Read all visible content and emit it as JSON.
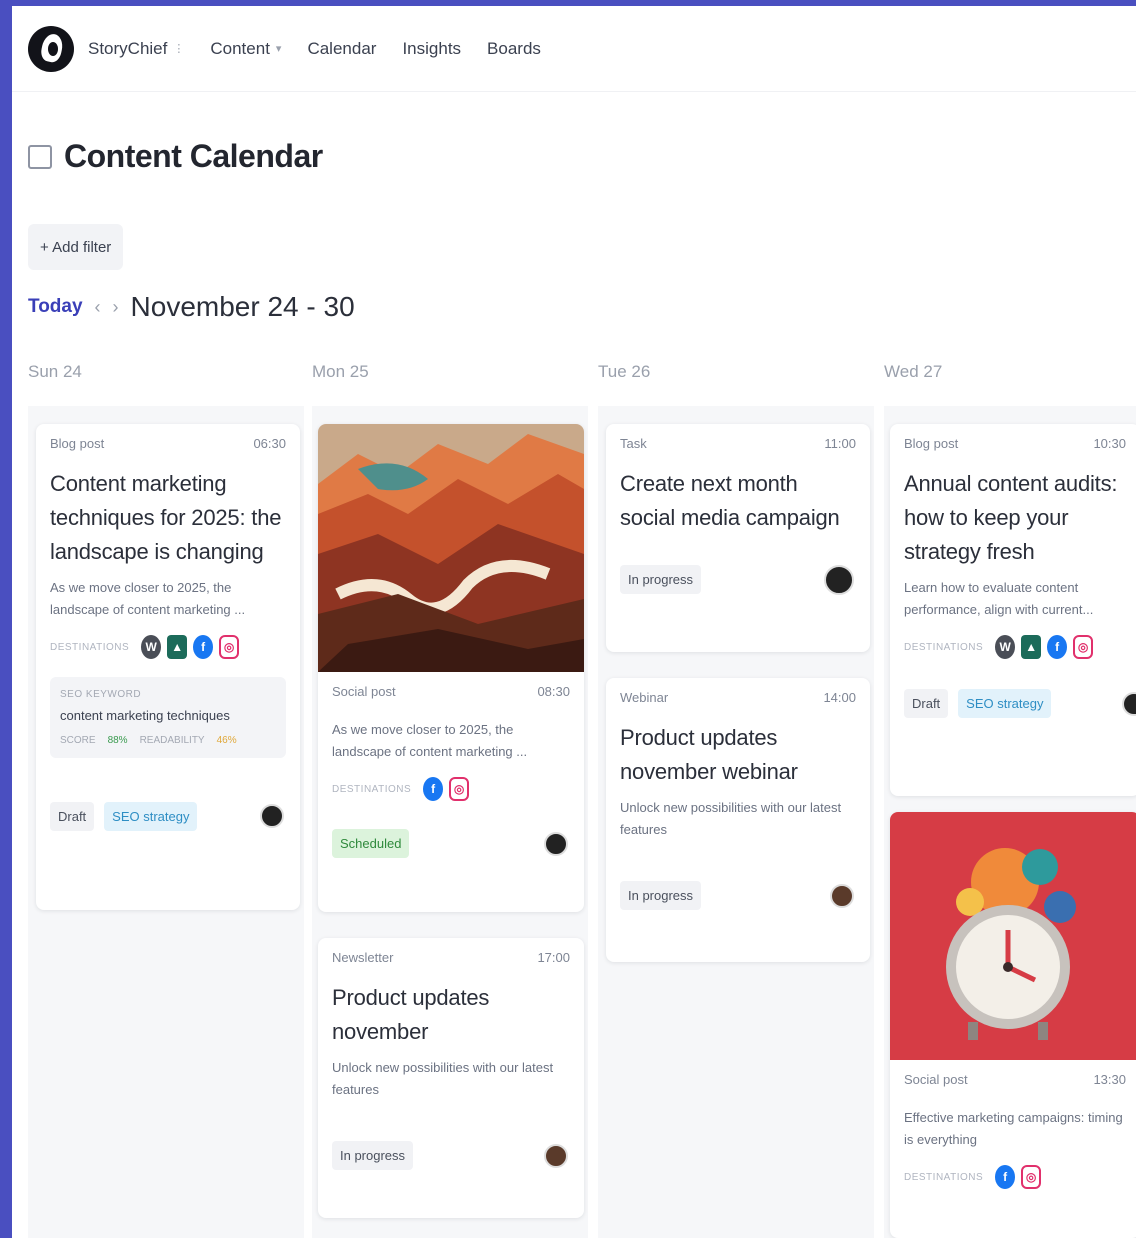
{
  "nav": {
    "workspace": "StoryChief",
    "workspace_caret": "⋮",
    "content": "Content",
    "content_caret": "▾",
    "calendar": "Calendar",
    "insights": "Insights",
    "boards": "Boards"
  },
  "page": {
    "title": "Content Calendar",
    "add_filter": "+ Add filter",
    "today": "Today",
    "prev": "‹",
    "next": "›",
    "date_range": "November 24 - 30"
  },
  "days": [
    {
      "label": "Sun 24"
    },
    {
      "label": "Mon 25"
    },
    {
      "label": "Tue 26"
    },
    {
      "label": "Wed 27"
    }
  ],
  "cards": {
    "sun_blog": {
      "type": "Blog post",
      "time": "06:30",
      "title": "Content marketing techniques for 2025: the landscape is changing",
      "desc": "As we move closer to 2025, the landscape of content marketing ...",
      "schedule_label": "DESTINATIONS",
      "seo_label": "SEO KEYWORD",
      "seo_keyword": "content marketing techniques",
      "seo_score_label": "SCORE",
      "seo_score": "88%",
      "readability_label": "READABILITY",
      "readability": "46%",
      "status": "Draft",
      "tag": "SEO strategy"
    },
    "mon_social": {
      "type": "Social post",
      "time": "08:30",
      "desc": "As we move closer to 2025, the landscape of content marketing ...",
      "schedule_label": "DESTINATIONS",
      "status": "Scheduled"
    },
    "mon_newsletter": {
      "type": "Newsletter",
      "time": "17:00",
      "title": "Product updates november",
      "desc": "Unlock new possibilities with our latest features",
      "status": "In progress"
    },
    "tue_task": {
      "type": "Task",
      "time": "11:00",
      "title": "Create next month social media campaign",
      "status": "In progress"
    },
    "tue_webinar": {
      "type": "Webinar",
      "time": "14:00",
      "title": "Product updates november webinar",
      "desc": "Unlock new possibilities with our latest features",
      "status": "In progress"
    },
    "wed_blog": {
      "type": "Blog post",
      "time": "10:30",
      "title": "Annual content audits: how to keep your strategy fresh",
      "desc": "Learn how to evaluate content performance, align with current...",
      "schedule_label": "DESTINATIONS",
      "status": "Draft",
      "tag": "SEO strategy"
    },
    "wed_social": {
      "type": "Social post",
      "time": "13:30",
      "desc": "Effective marketing campaigns: timing is everything",
      "schedule_label": "DESTINATIONS"
    }
  },
  "colors": {
    "accent": "#3a3fb8",
    "frame": "#4a4fc0",
    "clock_bg": "#d63c45"
  }
}
